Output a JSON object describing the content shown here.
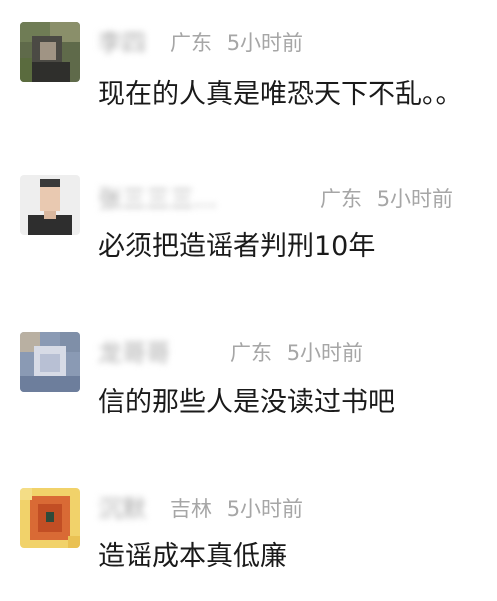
{
  "comments": [
    {
      "username": "李四",
      "location": "广东",
      "time": "5小时前",
      "text": "现在的人真是唯恐天下不乱。。"
    },
    {
      "username": "张三三三...",
      "location": "广东",
      "time": "5小时前",
      "text": "必须把造谣者判刑10年"
    },
    {
      "username": "龙哥哥",
      "location": "广东",
      "time": "5小时前",
      "text": "信的那些人是没读过书吧"
    },
    {
      "username": "沉默",
      "location": "吉林",
      "time": "5小时前",
      "text": "造谣成本真低廉"
    }
  ]
}
